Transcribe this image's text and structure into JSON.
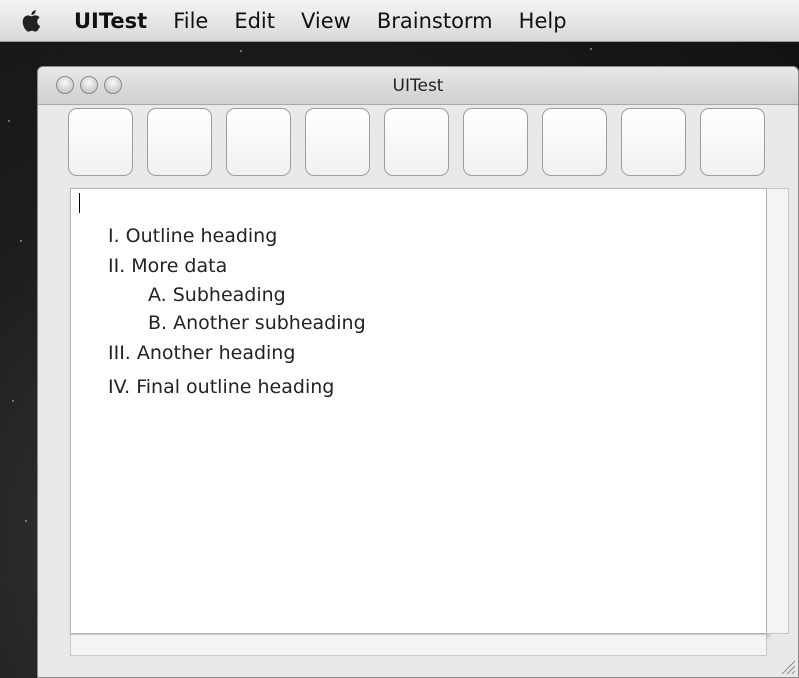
{
  "menubar": {
    "apple_icon": "apple-icon",
    "items": [
      "UITest",
      "File",
      "Edit",
      "View",
      "Brainstorm",
      "Help"
    ]
  },
  "window": {
    "title": "UITest",
    "toolbar_button_count": 9,
    "editor": {
      "lines": [
        "I. Outline heading",
        "II. More data",
        "A. Subheading",
        "B. Another subheading",
        "III. Another heading",
        "IV. Final outline heading"
      ]
    }
  },
  "colors": {
    "menubar_top": "#f4f4f4",
    "window_bg": "#e9e9e9",
    "editor_bg": "#ffffff"
  }
}
